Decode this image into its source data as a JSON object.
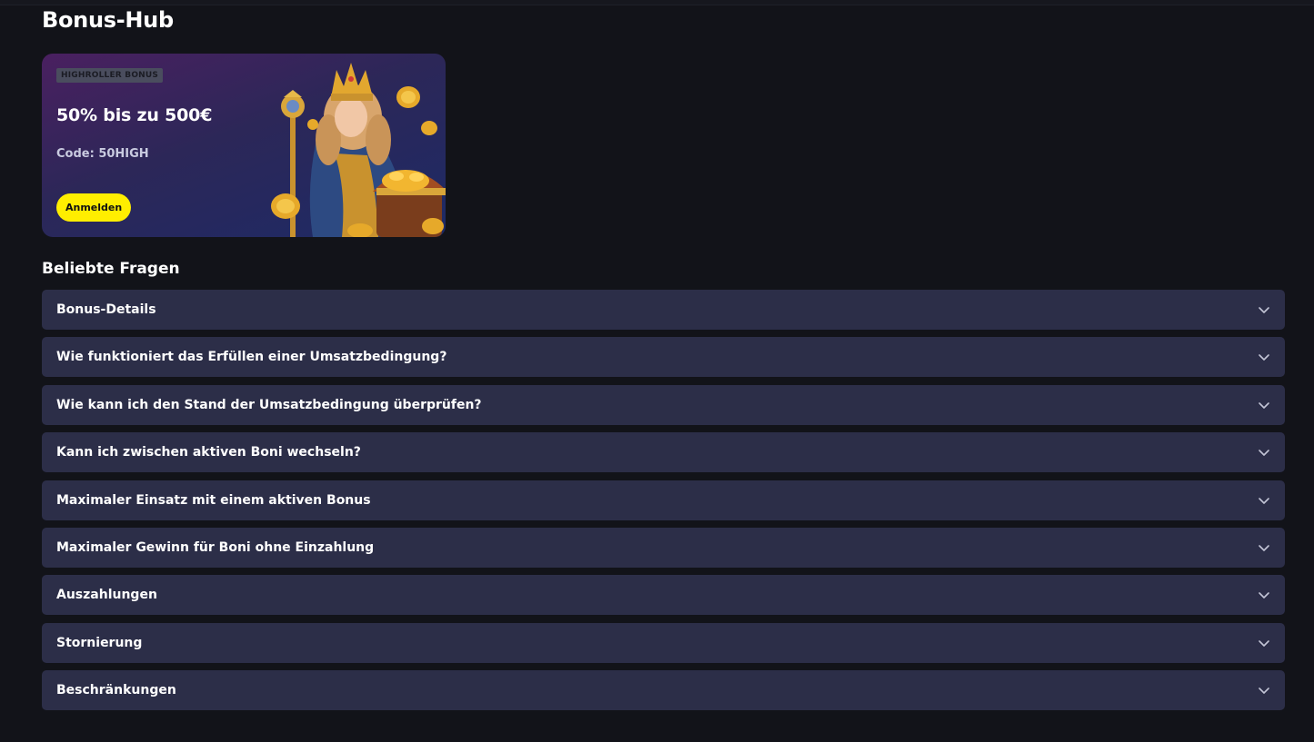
{
  "page": {
    "title": "Bonus-Hub"
  },
  "bonus_card": {
    "badge": "HIGHROLLER BONUS",
    "headline": "50% bis zu 500€",
    "code": "Code: 50HIGH",
    "cta_label": "Anmelden"
  },
  "faq": {
    "title": "Beliebte Fragen",
    "items": [
      {
        "label": "Bonus-Details"
      },
      {
        "label": "Wie funktioniert das Erfüllen einer Umsatzbedingung?"
      },
      {
        "label": "Wie kann ich den Stand der Umsatzbedingung überprüfen?"
      },
      {
        "label": "Kann ich zwischen aktiven Boni wechseln?"
      },
      {
        "label": "Maximaler Einsatz mit einem aktiven Bonus"
      },
      {
        "label": "Maximaler Gewinn für Boni ohne Einzahlung"
      },
      {
        "label": "Auszahlungen"
      },
      {
        "label": "Stornierung"
      },
      {
        "label": "Beschränkungen"
      }
    ]
  },
  "icons": {
    "accordion": "chevron-down-icon"
  },
  "colors": {
    "background": "#121319",
    "accordion_bg": "#2c2e48",
    "cta": "#ffee00"
  }
}
